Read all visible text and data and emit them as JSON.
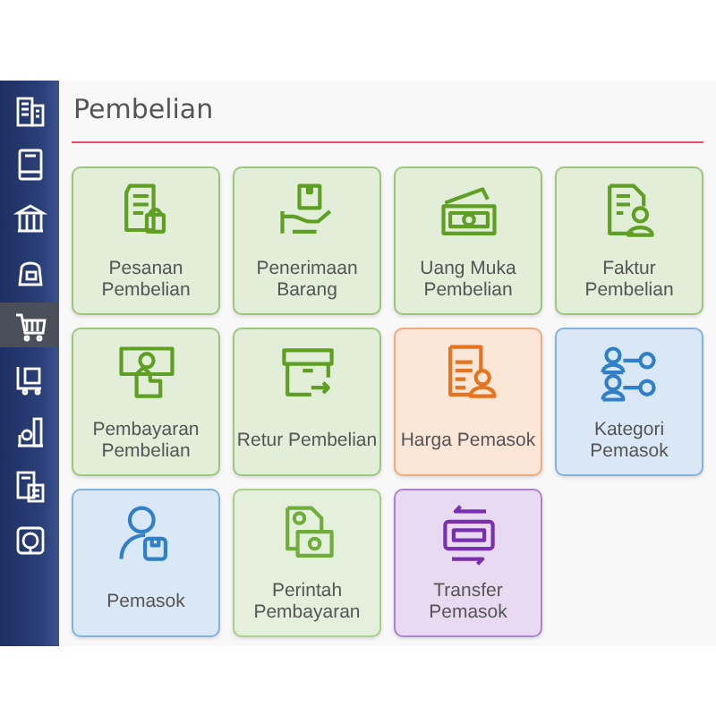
{
  "sidebar": {
    "items": [
      {
        "selected": false
      },
      {
        "selected": false
      },
      {
        "selected": false
      },
      {
        "selected": false
      },
      {
        "selected": true
      },
      {
        "selected": false
      },
      {
        "selected": false
      },
      {
        "selected": false
      },
      {
        "selected": false
      }
    ]
  },
  "title": "Pembelian",
  "tiles": [
    {
      "label": "Pesanan Pembelian",
      "color": "#5f9f24"
    },
    {
      "label": "Penerimaan Barang",
      "color": "#5f9f24"
    },
    {
      "label": "Uang Muka Pembelian",
      "color": "#5f9f24"
    },
    {
      "label": "Faktur Pembelian",
      "color": "#5f9f24"
    },
    {
      "label": "Pembayaran Pembelian",
      "color": "#5f9f24"
    },
    {
      "label": "Retur Pembelian",
      "color": "#5f9f24"
    },
    {
      "label": "Harga Pemasok",
      "color": "#e8731f"
    },
    {
      "label": "Kategori Pemasok",
      "color": "#2f7fc9"
    },
    {
      "label": "Pemasok",
      "color": "#2f7fc9"
    },
    {
      "label": "Perintah Pembayaran",
      "color": "#6fae3a"
    },
    {
      "label": "Transfer Pemasok",
      "color": "#7a2fb0"
    }
  ]
}
